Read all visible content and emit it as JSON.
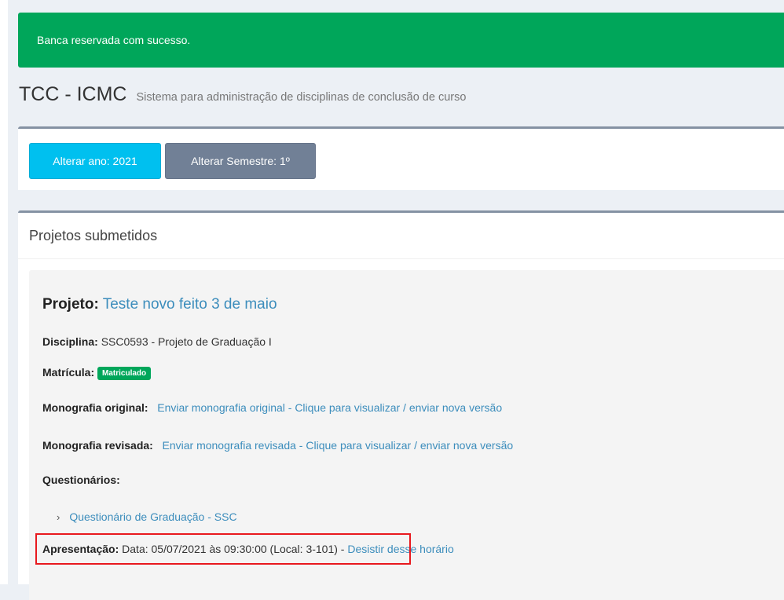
{
  "alert": {
    "message": "Banca reservada com sucesso."
  },
  "header": {
    "title": "TCC - ICMC",
    "subtitle": "Sistema para administração de disciplinas de conclusão de curso"
  },
  "filters": {
    "year_button": "Alterar ano: 2021",
    "semester_button": "Alterar Semestre: 1º"
  },
  "projects": {
    "box_title": "Projetos submetidos",
    "project": {
      "label": "Projeto:",
      "name": "Teste novo feito 3 de maio",
      "disciplina_label": "Disciplina:",
      "disciplina_value": "SSC0593 - Projeto de Graduação I",
      "matricula_label": "Matrícula:",
      "matricula_badge": "Matriculado",
      "mono_original_label": "Monografia original:",
      "mono_original_link": "Enviar monografia original - Clique para visualizar / enviar nova versão",
      "mono_revisada_label": "Monografia revisada:",
      "mono_revisada_link": "Enviar monografia revisada - Clique para visualizar / enviar nova versão",
      "questionarios_label": "Questionários:",
      "questionario_item": "Questionário de Graduação - SSC",
      "apresentacao_label": "Apresentação:",
      "apresentacao_value": "Data: 05/07/2021 às 09:30:00 (Local: 3-101)",
      "separator": "-",
      "desistir_link": "Desistir desse horário"
    }
  },
  "colors": {
    "success": "#00a65a",
    "info": "#00c0ef",
    "secondary": "#718096",
    "link": "#3c8dbc",
    "highlight": "#e8191e"
  }
}
